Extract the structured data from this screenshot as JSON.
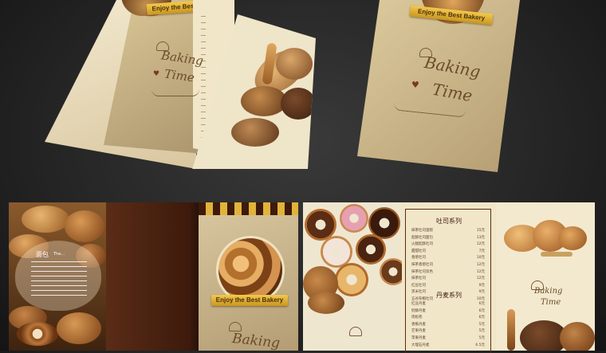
{
  "brand": {
    "ribbon_text": "Enjoy the Best Bakery",
    "ribbon_text_short": "Enjoy the Best Bake",
    "title_line1": "Baking",
    "title_line2": "Time",
    "heart": "♥"
  },
  "panel_intro": {
    "heading": "面包",
    "subheading": "The..."
  },
  "menu": {
    "section1_title": "吐司系列",
    "section2_title": "丹麦系列",
    "section1_items": [
      {
        "name": "抹茶吐司蛋糕",
        "price": "15元"
      },
      {
        "name": "起酥吐司面包",
        "price": "13元"
      },
      {
        "name": "火腿起酥吐司",
        "price": "12元"
      },
      {
        "name": "甜甜吐司",
        "price": "7元"
      },
      {
        "name": "香葱吐司",
        "price": "10元"
      },
      {
        "name": "抹茶香葱吐司",
        "price": "12元"
      },
      {
        "name": "抹茶吐司双色",
        "price": "12元"
      },
      {
        "name": "抹茶吐司",
        "price": "12元"
      },
      {
        "name": "红豆吐司",
        "price": "9元"
      },
      {
        "name": "黑米吐司",
        "price": "9元"
      },
      {
        "name": "五谷杂粮吐司",
        "price": "10元"
      }
    ],
    "section2_items": [
      {
        "name": "红豆丹麦",
        "price": "6元"
      },
      {
        "name": "奶酥丹麦",
        "price": "6元"
      },
      {
        "name": "肉松卷",
        "price": "6元"
      },
      {
        "name": "香蕉丹麦",
        "price": "5元"
      },
      {
        "name": "芒果丹麦",
        "price": "5元"
      },
      {
        "name": "苹果丹麦",
        "price": "5元"
      },
      {
        "name": "大理石丹麦",
        "price": "6.5元"
      },
      {
        "name": "椰蓉丹麦",
        "price": "6元"
      },
      {
        "name": "热狗丹麦",
        "price": "6元"
      }
    ]
  },
  "colors": {
    "cream": "#efe3c2",
    "tan": "#c7b287",
    "dark_brown": "#4a2412",
    "gold": "#e1b33a"
  }
}
